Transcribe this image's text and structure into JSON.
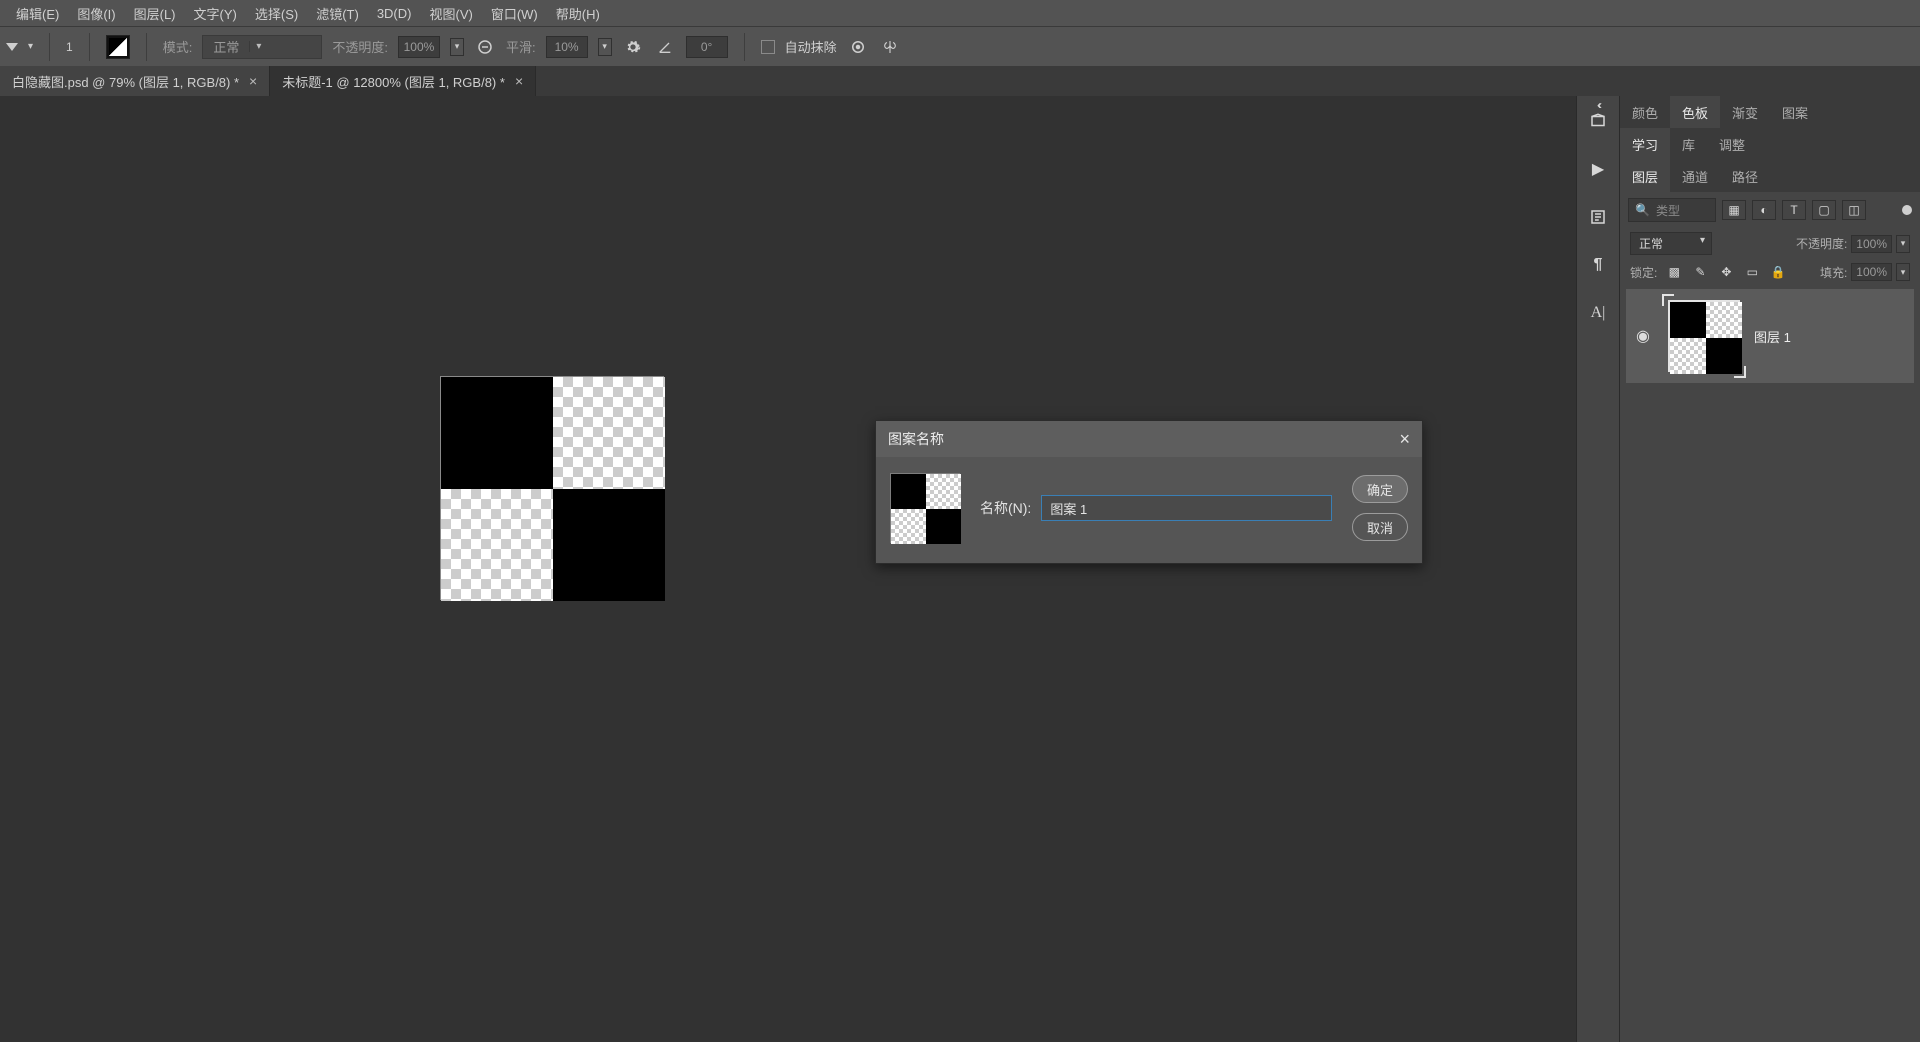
{
  "menu": {
    "edit": "编辑(E)",
    "image": "图像(I)",
    "layer": "图层(L)",
    "type": "文字(Y)",
    "select": "选择(S)",
    "filter": "滤镜(T)",
    "threeD": "3D(D)",
    "view": "视图(V)",
    "window": "窗口(W)",
    "help": "帮助(H)"
  },
  "options": {
    "brush_size": "1",
    "mode_label": "模式:",
    "mode_value": "正常",
    "opacity_label": "不透明度:",
    "opacity_value": "100%",
    "smoothing_label": "平滑:",
    "smoothing_value": "10%",
    "angle_icon_value": "0°",
    "auto_erase_label": "自动抹除"
  },
  "tabs": [
    {
      "label": "白隐藏图.psd @ 79% (图层 1, RGB/8) *",
      "active": false
    },
    {
      "label": "未标题-1 @ 12800% (图层 1, RGB/8) *",
      "active": true
    }
  ],
  "panels": {
    "row1": {
      "color": "颜色",
      "swatches": "色板",
      "gradients": "渐变",
      "patterns": "图案"
    },
    "row2": {
      "learn": "学习",
      "libraries": "库",
      "adjustments": "调整"
    },
    "row3": {
      "layers": "图层",
      "channels": "通道",
      "paths": "路径"
    }
  },
  "layers": {
    "search_placeholder": "类型",
    "blend_mode": "正常",
    "opacity_label": "不透明度:",
    "opacity_value": "100%",
    "lock_label": "锁定:",
    "fill_label": "填充:",
    "fill_value": "100%",
    "entry_name": "图层 1"
  },
  "dialog": {
    "title": "图案名称",
    "field_label": "名称(N):",
    "field_value": "图案 1",
    "ok": "确定",
    "cancel": "取消"
  }
}
